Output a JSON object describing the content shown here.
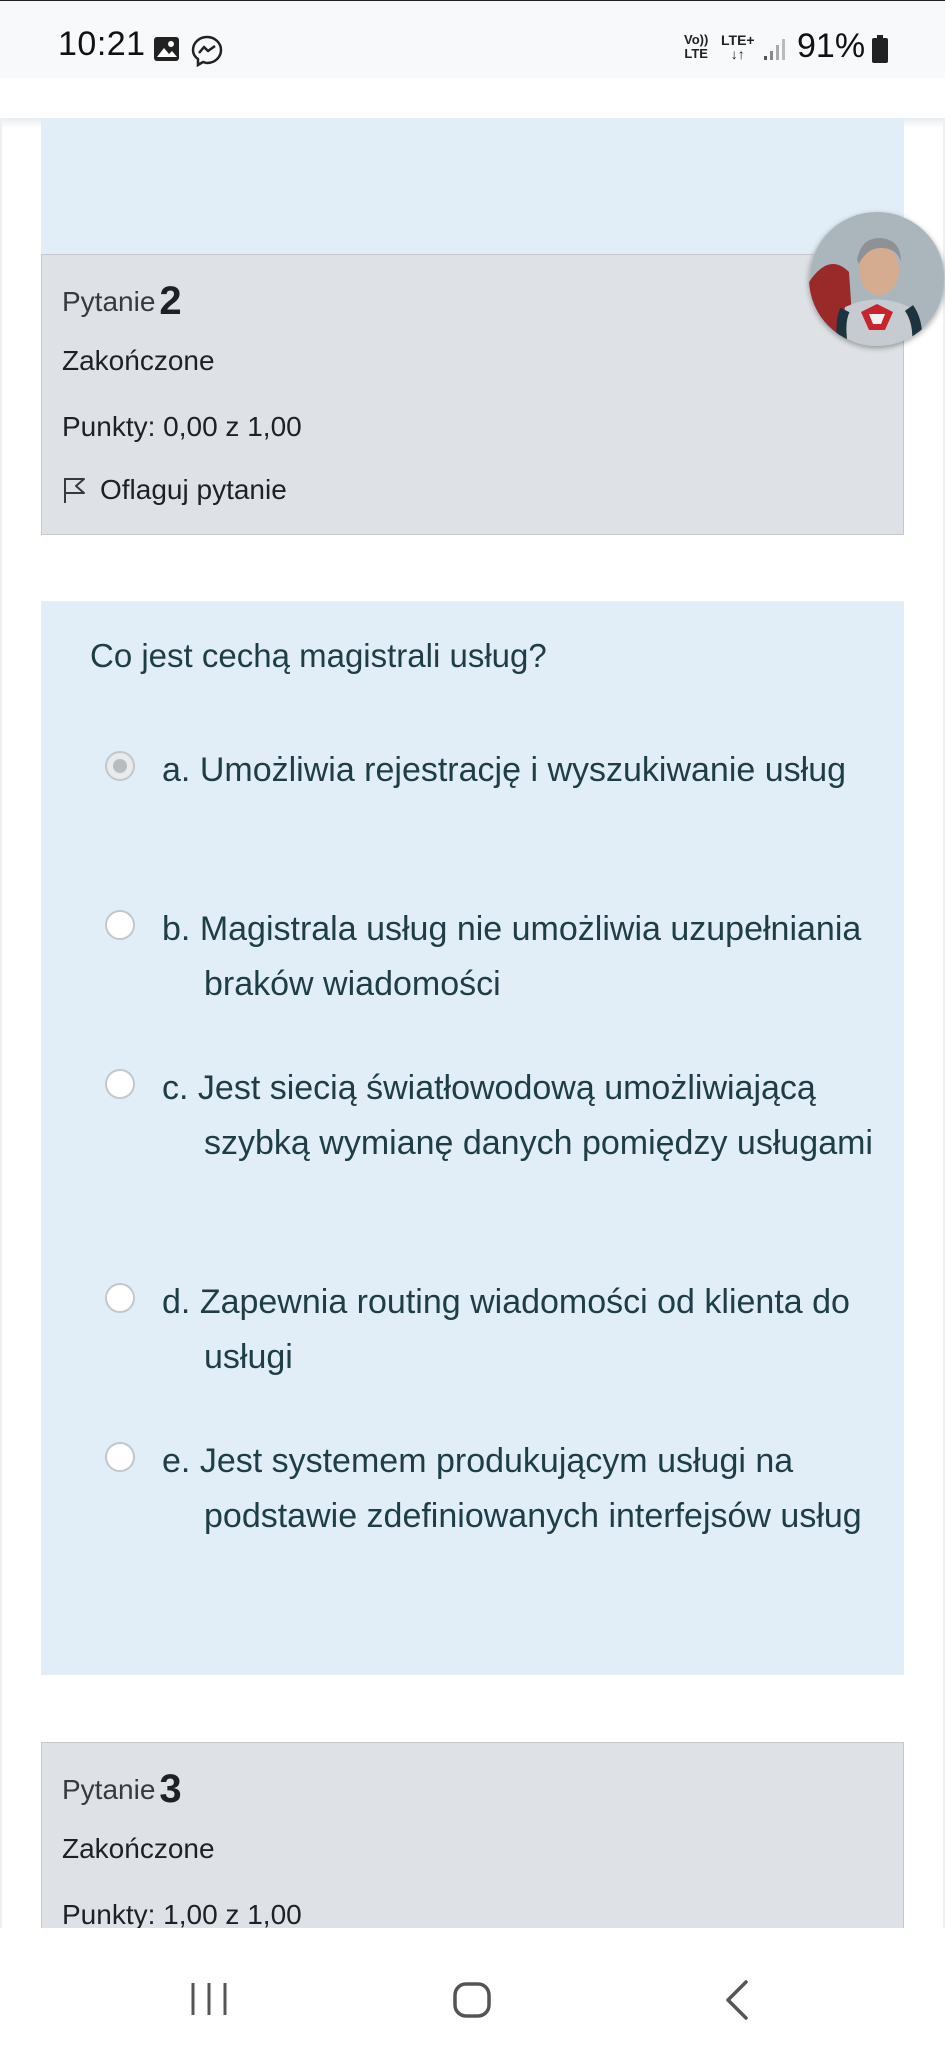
{
  "status_bar": {
    "time": "10:21",
    "volte": "Vo))\nLTE",
    "network": "LTE+\n↓↑",
    "battery": "91%",
    "icons": [
      "gallery-icon",
      "messenger-icon",
      "signal-icon",
      "battery-icon"
    ]
  },
  "question_2": {
    "label": "Pytanie",
    "number": "2",
    "status": "Zakończone",
    "points": "Punkty: 0,00 z 1,00",
    "flag_label": "Oflaguj pytanie"
  },
  "question_text": "Co jest cechą magistrali usług?",
  "answers": [
    {
      "letter": "a.",
      "text": "Umożliwia rejestrację i wyszukiwanie usług",
      "selected": true
    },
    {
      "letter": "b.",
      "text": "Magistrala usług nie umożliwia uzupełniania braków wiadomości",
      "selected": false
    },
    {
      "letter": "c.",
      "text": "Jest siecią światłowodową umożliwiającą szybką wymianę danych pomiędzy usługami",
      "selected": false
    },
    {
      "letter": "d.",
      "text": "Zapewnia routing wiadomości od klienta do usługi",
      "selected": false
    },
    {
      "letter": "e.",
      "text": "Jest systemem produkującym usługi na podstawie zdefiniowanych interfejsów usług",
      "selected": false
    }
  ],
  "question_3": {
    "label": "Pytanie",
    "number": "3",
    "status": "Zakończone",
    "points": "Punkty: 1,00 z 1,00"
  },
  "colors": {
    "question_bg": "#e1eef7",
    "info_bg": "#dee2e6",
    "question_text": "#1e3d46"
  }
}
